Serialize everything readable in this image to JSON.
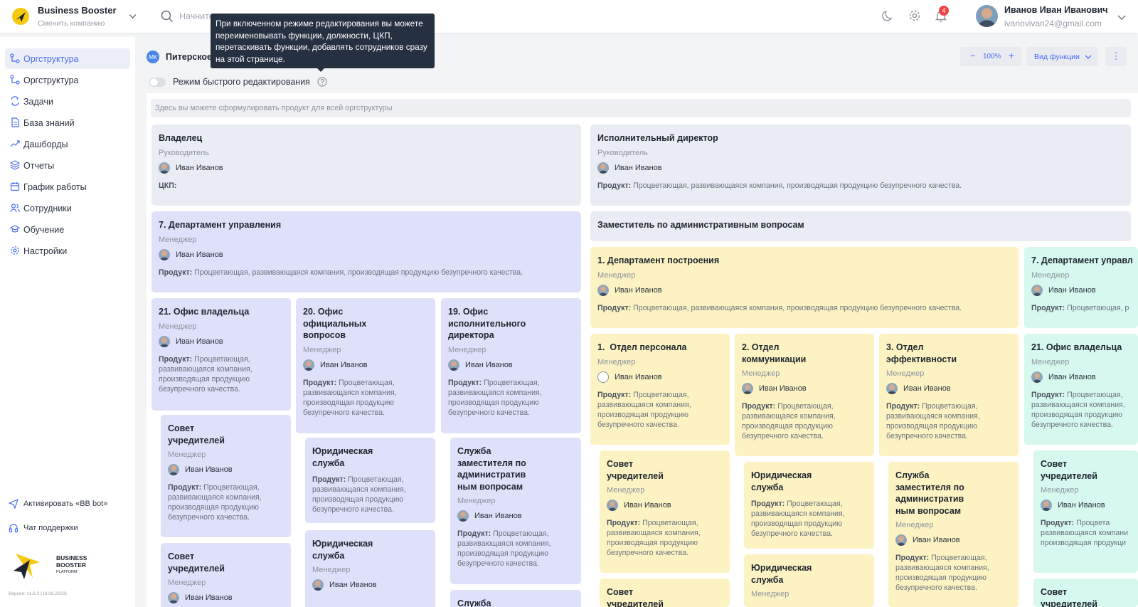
{
  "brand": {
    "name": "Business Booster",
    "switch_company": "Сменить компанию",
    "logo_text": [
      "BUSINESS",
      "BOOSTER",
      "PLATFORM"
    ]
  },
  "search": {
    "placeholder": "Начните"
  },
  "notifications": {
    "count": "4"
  },
  "user": {
    "name": "Иванов Иван Иванович",
    "email": "ivanovivan24@gmail.com"
  },
  "tooltip": {
    "text": "При включенном режиме редактирования вы можете переименовывать функции, должности, ЦКП, перетаскивать функции, добавлять сотрудников сразу на этой странице."
  },
  "sidebar": {
    "items": [
      {
        "label": "Оргструктура",
        "icon": "org-icon",
        "active": true
      },
      {
        "label": "Оргструктура",
        "icon": "org-icon"
      },
      {
        "label": "Задачи",
        "icon": "tasks-icon"
      },
      {
        "label": "База знаний",
        "icon": "document-icon"
      },
      {
        "label": "Дашборды",
        "icon": "trend-icon"
      },
      {
        "label": "Отчеты",
        "icon": "layers-icon"
      },
      {
        "label": "График работы",
        "icon": "calendar-icon"
      },
      {
        "label": "Сотрудники",
        "icon": "users-icon"
      },
      {
        "label": "Обучение",
        "icon": "graduation-cap-icon"
      },
      {
        "label": "Настройки",
        "icon": "gear-icon"
      }
    ],
    "bot_link": "Активировать «BB bot»",
    "support_link": "Чат поддержки",
    "version": "Версия: v1.8.3 (18.06.2023)"
  },
  "header": {
    "org_badge": "МК",
    "org_name": "Питерское",
    "quick_edit_label": "Режим быстрого редактирования",
    "zoom": {
      "minus": "−",
      "value": "100%",
      "plus": "+"
    },
    "view_label": "Вид функции",
    "more": "⋮"
  },
  "canvas": {
    "product_placeholder": "Здесь вы можете сформулировать продукт для всей оргструктуры",
    "product_label": "Продукт:",
    "product_text": "Процветающая, развивающаяся компания, производящая продукцию безупречного качества.",
    "cards": [
      {
        "title": "Владелец",
        "role": "Руководитель",
        "person": "Иван Иванов",
        "ckp": "ЦКП:"
      },
      {
        "title": "Исполнительный директор",
        "role": "Руководитель",
        "person": "Иван Иванов"
      },
      {
        "title": "7. Департамент управления",
        "role": "Менеджер",
        "person": "Иван Иванов"
      },
      {
        "title": "Заместитель по административным вопросам"
      },
      {
        "title": "1. Департамент построения",
        "role": "Менеджер",
        "person": "Иван Иванов"
      },
      {
        "title": "7. Департамент управл",
        "role": "Менеджер",
        "person": "Иван Иванов",
        "product_short": "Процветающая, р"
      },
      {
        "title": "21. Офис владельца",
        "role": "Менеджер",
        "person": "Иван Иванов"
      },
      {
        "title": "20.  Офис официальных вопросов",
        "role": "Менеджер",
        "person": "Иван Иванов"
      },
      {
        "title": "19. Офис исполнительного директора",
        "role": "Менеджер",
        "person": "Иван Иванов"
      },
      {
        "title": "1.  Отдел персонала",
        "role": "Менеджер",
        "person": "Иван Иванов"
      },
      {
        "title": "2. Отдел коммуникации",
        "role": "Менеджер",
        "person": "Иван Иванов"
      },
      {
        "title": "3.  Отдел эффективности",
        "role": "Менеджер",
        "person": "Иван Иванов"
      },
      {
        "title": "21. Офис владельца",
        "role": "Менеджер",
        "person": "Иван Иванов"
      },
      {
        "title": "Совет учредителей",
        "role": "Менеджер",
        "person": "Иван Иванов"
      },
      {
        "title": "Юридическая служба"
      },
      {
        "title": "Служба заместителя по административ ным вопросам",
        "role": "Менеджер",
        "person": "Иван Иванов"
      },
      {
        "title": "Совет учредителей",
        "role": "Менеджер",
        "person": "Иван Иванов"
      },
      {
        "title": "Юридическая служба",
        "role": "Менеджер",
        "person": "Иван Иванов"
      },
      {
        "title": "Служба"
      },
      {
        "title": "Совет учредителей",
        "role": "Менеджер",
        "person": "Иван Иванов"
      },
      {
        "title": "Юридическая служба"
      },
      {
        "title": "Служба заместителя по административ ным вопросам",
        "role": "Менеджер",
        "person": "Иван Иванов"
      },
      {
        "title": "Совет учредителей",
        "role": "Менеджер",
        "person": "Иван Иванов",
        "product_short": "Процвета",
        "product_short2": "развивающаяся компани",
        "product_short3": "производящая продукци"
      },
      {
        "title": "Совет учредителей"
      },
      {
        "title": "Юридическая служба",
        "role": "Менеджер"
      },
      {
        "title": "Совет учредителей"
      }
    ]
  },
  "colors": {
    "accent": "#4a6cf7",
    "gray_card": "#eaecf3",
    "blue_card": "#dfe1fa",
    "yellow_card": "#fdf3c2",
    "teal_card": "#d7f8ee",
    "badge": "#ef4444"
  }
}
